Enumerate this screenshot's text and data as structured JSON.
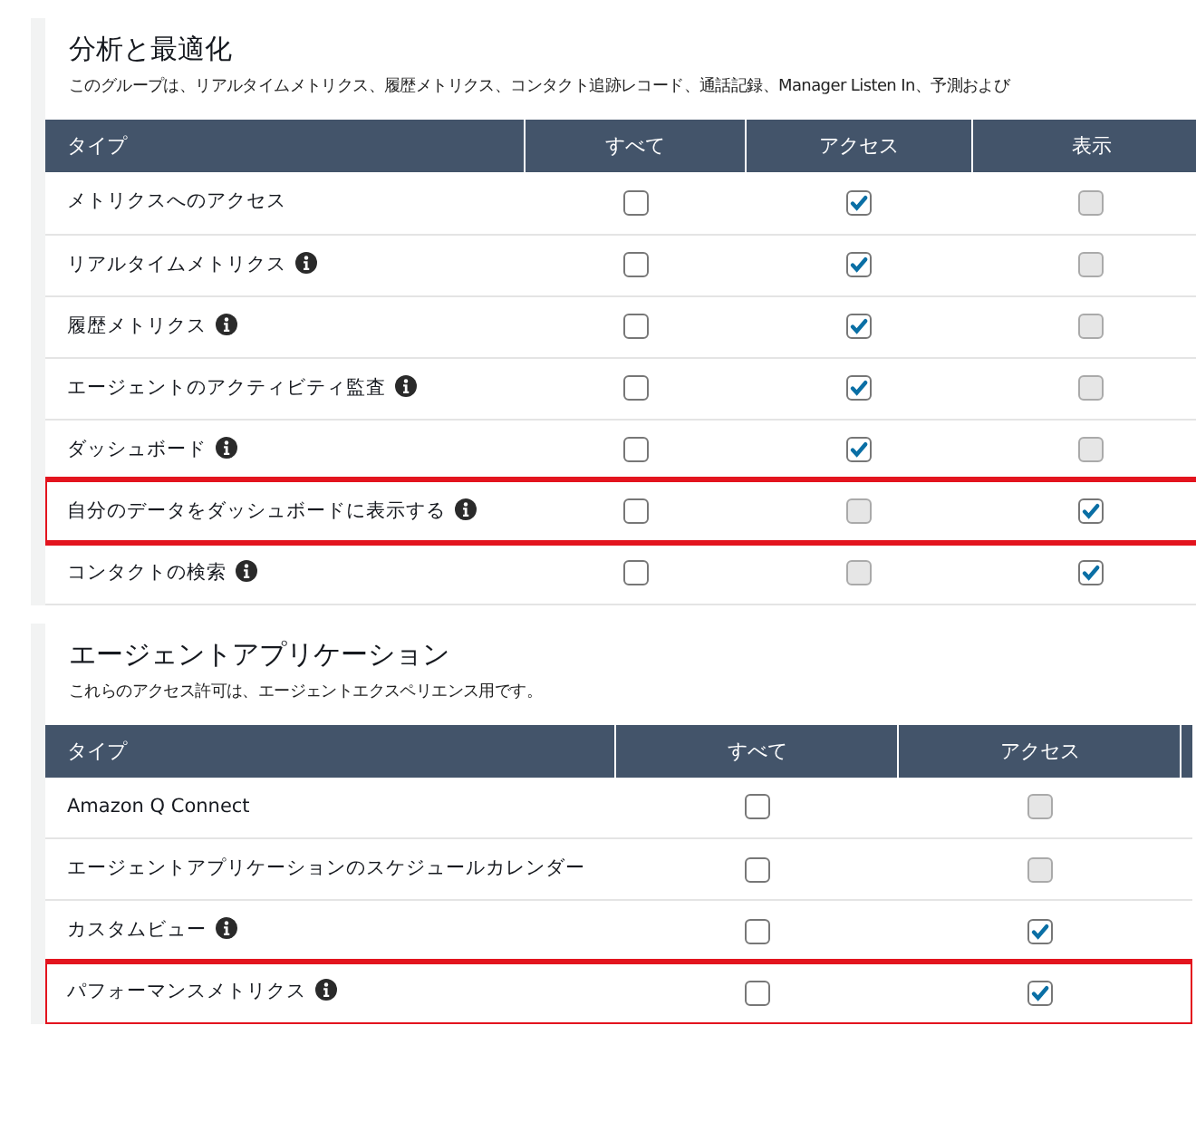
{
  "sections": [
    {
      "title": "分析と最適化",
      "description": "このグループは、リアルタイムメトリクス、履歴メトリクス、コンタクト追跡レコード、通話記録、Manager Listen In、予測および",
      "columns": [
        "タイプ",
        "すべて",
        "アクセス",
        "表示"
      ],
      "rows": [
        {
          "label": "メトリクスへのアクセス",
          "info": false,
          "highlighted": false,
          "cells": [
            {
              "checked": false,
              "disabled": false
            },
            {
              "checked": true,
              "disabled": false
            },
            {
              "checked": false,
              "disabled": true
            }
          ]
        },
        {
          "label": "リアルタイムメトリクス",
          "info": true,
          "highlighted": false,
          "cells": [
            {
              "checked": false,
              "disabled": false
            },
            {
              "checked": true,
              "disabled": false
            },
            {
              "checked": false,
              "disabled": true
            }
          ]
        },
        {
          "label": "履歴メトリクス",
          "info": true,
          "highlighted": false,
          "cells": [
            {
              "checked": false,
              "disabled": false
            },
            {
              "checked": true,
              "disabled": false
            },
            {
              "checked": false,
              "disabled": true
            }
          ]
        },
        {
          "label": "エージェントのアクティビティ監査",
          "info": true,
          "highlighted": false,
          "cells": [
            {
              "checked": false,
              "disabled": false
            },
            {
              "checked": true,
              "disabled": false
            },
            {
              "checked": false,
              "disabled": true
            }
          ]
        },
        {
          "label": "ダッシュボード",
          "info": true,
          "highlighted": false,
          "cells": [
            {
              "checked": false,
              "disabled": false
            },
            {
              "checked": true,
              "disabled": false
            },
            {
              "checked": false,
              "disabled": true
            }
          ]
        },
        {
          "label": "自分のデータをダッシュボードに表示する",
          "info": true,
          "highlighted": true,
          "cells": [
            {
              "checked": false,
              "disabled": false
            },
            {
              "checked": false,
              "disabled": true
            },
            {
              "checked": true,
              "disabled": false
            }
          ]
        },
        {
          "label": "コンタクトの検索",
          "info": true,
          "highlighted": false,
          "cells": [
            {
              "checked": false,
              "disabled": false
            },
            {
              "checked": false,
              "disabled": true
            },
            {
              "checked": true,
              "disabled": false
            }
          ]
        }
      ]
    },
    {
      "title": "エージェントアプリケーション",
      "description": "これらのアクセス許可は、エージェントエクスペリエンス用です。",
      "columns": [
        "タイプ",
        "すべて",
        "アクセス"
      ],
      "rows": [
        {
          "label": "Amazon Q Connect",
          "info": false,
          "highlighted": false,
          "cells": [
            {
              "checked": false,
              "disabled": false
            },
            {
              "checked": false,
              "disabled": true
            }
          ]
        },
        {
          "label": "エージェントアプリケーションのスケジュールカレンダー",
          "info": false,
          "highlighted": false,
          "cells": [
            {
              "checked": false,
              "disabled": false
            },
            {
              "checked": false,
              "disabled": true
            }
          ]
        },
        {
          "label": "カスタムビュー",
          "info": true,
          "highlighted": false,
          "cells": [
            {
              "checked": false,
              "disabled": false
            },
            {
              "checked": true,
              "disabled": false
            }
          ]
        },
        {
          "label": "パフォーマンスメトリクス",
          "info": true,
          "highlighted": true,
          "cells": [
            {
              "checked": false,
              "disabled": false
            },
            {
              "checked": true,
              "disabled": false
            }
          ]
        }
      ]
    }
  ]
}
